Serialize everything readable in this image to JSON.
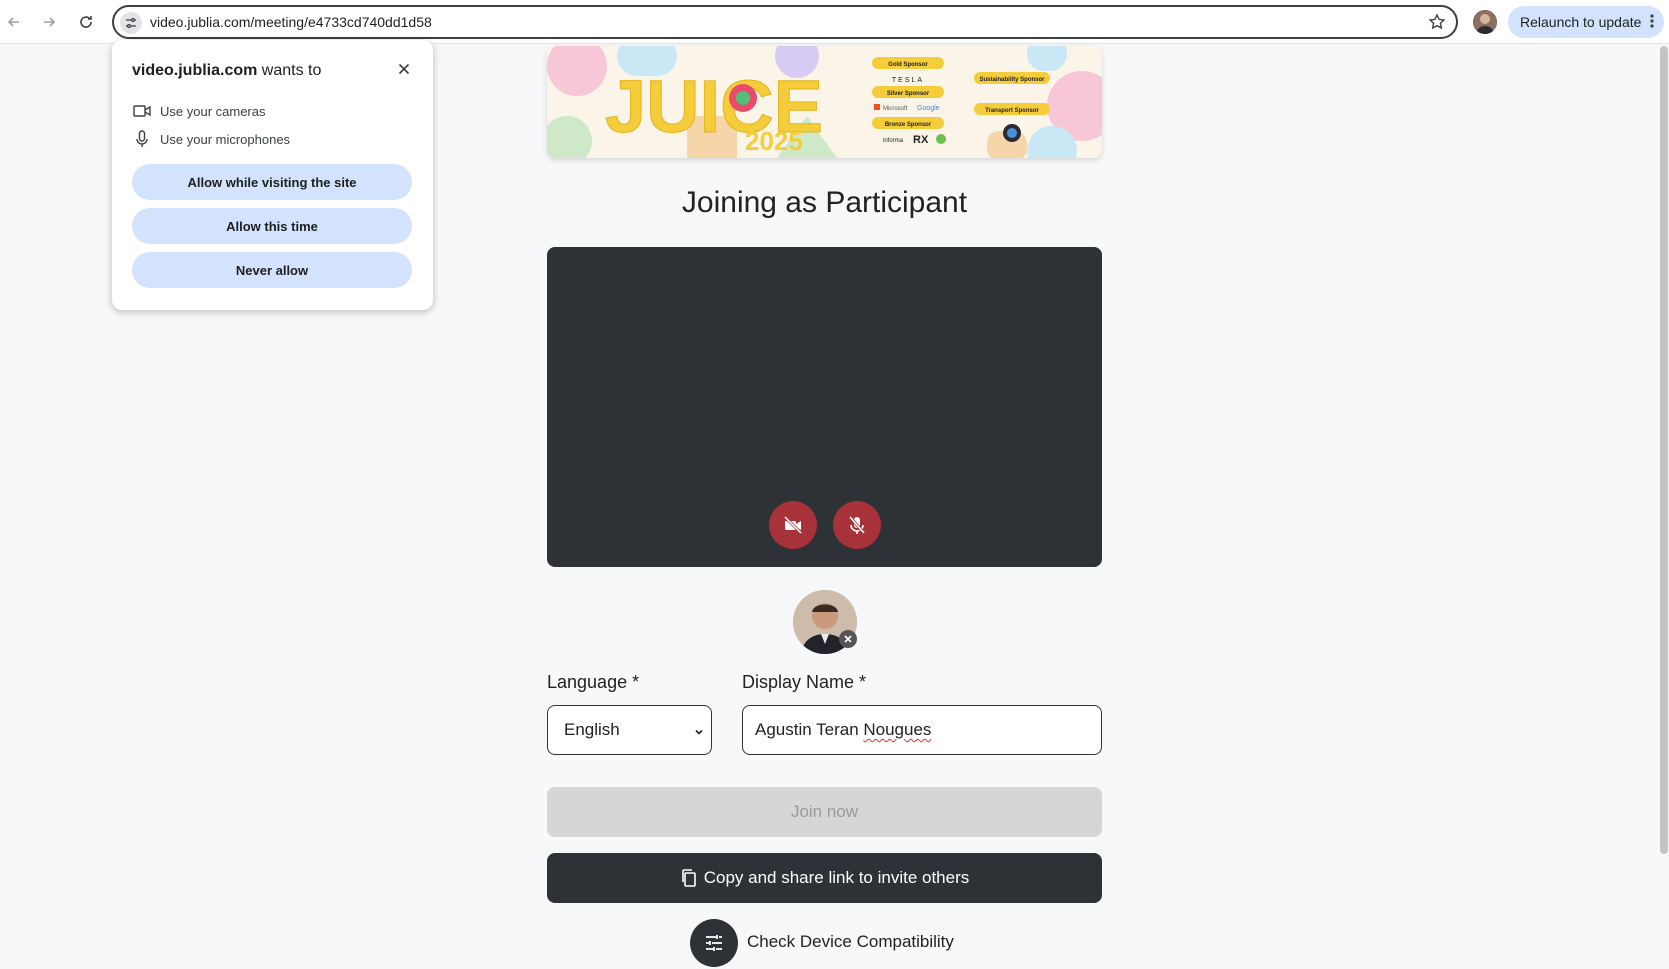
{
  "browser": {
    "url": "video.jublia.com/meeting/e4733cd740dd1d58",
    "relaunch_label": "Relaunch to update",
    "icons": [
      "back-arrow-icon",
      "forward-arrow-icon",
      "reload-icon",
      "site-info-icon",
      "bookmark-star-icon",
      "profile-avatar",
      "more-vert-icon"
    ]
  },
  "permission_popup": {
    "site": "video.jublia.com",
    "wants_to": " wants to",
    "camera_label": "Use your cameras",
    "microphone_label": "Use your microphones",
    "allow_visiting_label": "Allow while visiting the site",
    "allow_once_label": "Allow this time",
    "never_allow_label": "Never allow"
  },
  "banner": {
    "event_name": "JUICE",
    "event_year": "2025",
    "sponsor_tiers": [
      "Gold Sponsor",
      "Silver Sponsor",
      "Bronze Sponsor",
      "Sustainability Sponsor",
      "Transport Sponsor"
    ],
    "sponsor_names": [
      "TESLA",
      "Microsoft",
      "Google",
      "informa",
      "RX"
    ]
  },
  "main": {
    "title": "Joining as Participant",
    "language_label": "Language *",
    "language_value": "English",
    "display_name_label": "Display Name *",
    "display_name_first": "Agustin Teran ",
    "display_name_last": "Nougues",
    "join_label": "Join now",
    "share_label": "Copy and share link to invite others",
    "check_label": "Check Device Compatibility"
  },
  "colors": {
    "accent_blue": "#d3e3fd",
    "dark": "#2e3135",
    "muted_red": "#a8323a",
    "disabled": "#d6d6d6"
  }
}
